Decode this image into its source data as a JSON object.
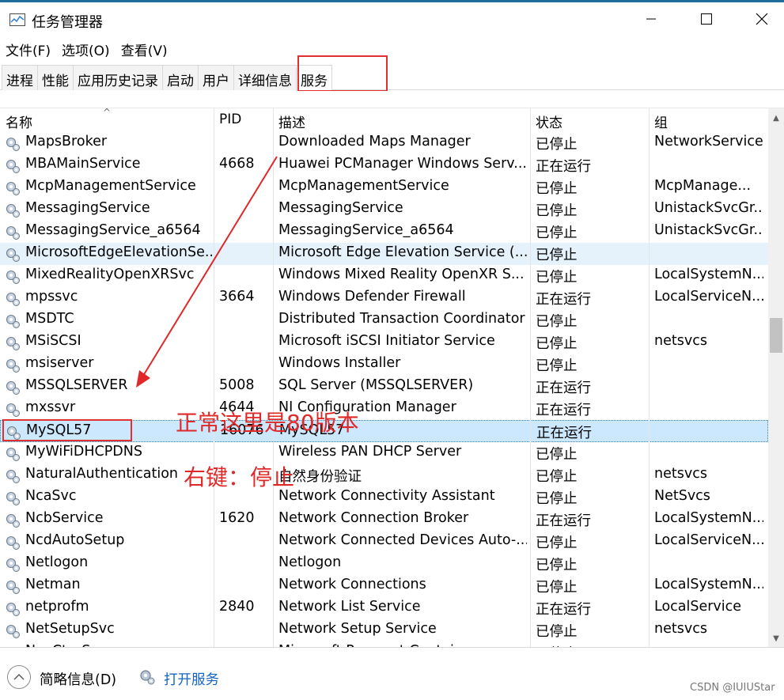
{
  "window": {
    "title": "任务管理器",
    "controls": {
      "minimize": "—",
      "maximize": "☐",
      "close": "✕"
    }
  },
  "menu": [
    "文件(F)",
    "选项(O)",
    "查看(V)"
  ],
  "tabs": [
    {
      "label": "进程",
      "active": false
    },
    {
      "label": "性能",
      "active": false
    },
    {
      "label": "应用历史记录",
      "active": false
    },
    {
      "label": "启动",
      "active": false
    },
    {
      "label": "用户",
      "active": false
    },
    {
      "label": "详细信息",
      "active": false
    },
    {
      "label": "服务",
      "active": true
    }
  ],
  "table": {
    "columns": {
      "name": "名称",
      "pid": "PID",
      "desc": "描述",
      "status": "状态",
      "group": "组"
    },
    "sort_indicator": "^",
    "rows": [
      {
        "name": "MapsBroker",
        "pid": "",
        "desc": "Downloaded Maps Manager",
        "status": "已停止",
        "group": "NetworkService",
        "state": "normal"
      },
      {
        "name": "MBAMainService",
        "pid": "4668",
        "desc": "Huawei PCManager Windows Serv...",
        "status": "正在运行",
        "group": "",
        "state": "normal"
      },
      {
        "name": "McpManagementService",
        "pid": "",
        "desc": "McpManagementService",
        "status": "已停止",
        "group": "McpManage...",
        "state": "normal"
      },
      {
        "name": "MessagingService",
        "pid": "",
        "desc": "MessagingService",
        "status": "已停止",
        "group": "UnistackSvcGr...",
        "state": "normal"
      },
      {
        "name": "MessagingService_a6564",
        "pid": "",
        "desc": "MessagingService_a6564",
        "status": "已停止",
        "group": "UnistackSvcGr...",
        "state": "normal"
      },
      {
        "name": "MicrosoftEdgeElevationSe...",
        "pid": "",
        "desc": "Microsoft Edge Elevation Service (...",
        "status": "已停止",
        "group": "",
        "state": "hover"
      },
      {
        "name": "MixedRealityOpenXRSvc",
        "pid": "",
        "desc": "Windows Mixed Reality OpenXR S...",
        "status": "已停止",
        "group": "LocalSystemN...",
        "state": "normal"
      },
      {
        "name": "mpssvc",
        "pid": "3664",
        "desc": "Windows Defender Firewall",
        "status": "正在运行",
        "group": "LocalServiceN...",
        "state": "normal"
      },
      {
        "name": "MSDTC",
        "pid": "",
        "desc": "Distributed Transaction Coordinator",
        "status": "已停止",
        "group": "",
        "state": "normal"
      },
      {
        "name": "MSiSCSI",
        "pid": "",
        "desc": "Microsoft iSCSI Initiator Service",
        "status": "已停止",
        "group": "netsvcs",
        "state": "normal"
      },
      {
        "name": "msiserver",
        "pid": "",
        "desc": "Windows Installer",
        "status": "已停止",
        "group": "",
        "state": "normal"
      },
      {
        "name": "MSSQLSERVER",
        "pid": "5008",
        "desc": "SQL Server (MSSQLSERVER)",
        "status": "正在运行",
        "group": "",
        "state": "normal"
      },
      {
        "name": "mxssvr",
        "pid": "4644",
        "desc": "NI Configuration Manager",
        "status": "正在运行",
        "group": "",
        "state": "normal"
      },
      {
        "name": "MySQL57",
        "pid": "16076",
        "desc": "MySQL57",
        "status": "正在运行",
        "group": "",
        "state": "selected"
      },
      {
        "name": "MyWiFiDHCPDNS",
        "pid": "",
        "desc": "Wireless PAN DHCP Server",
        "status": "已停止",
        "group": "",
        "state": "normal"
      },
      {
        "name": "NaturalAuthentication",
        "pid": "",
        "desc": "自然身份验证",
        "status": "已停止",
        "group": "netsvcs",
        "state": "normal"
      },
      {
        "name": "NcaSvc",
        "pid": "",
        "desc": "Network Connectivity Assistant",
        "status": "已停止",
        "group": "NetSvcs",
        "state": "normal"
      },
      {
        "name": "NcbService",
        "pid": "1620",
        "desc": "Network Connection Broker",
        "status": "正在运行",
        "group": "LocalSystemN...",
        "state": "normal"
      },
      {
        "name": "NcdAutoSetup",
        "pid": "",
        "desc": "Network Connected Devices Auto-...",
        "status": "已停止",
        "group": "LocalServiceN...",
        "state": "normal"
      },
      {
        "name": "Netlogon",
        "pid": "",
        "desc": "Netlogon",
        "status": "已停止",
        "group": "",
        "state": "normal"
      },
      {
        "name": "Netman",
        "pid": "",
        "desc": "Network Connections",
        "status": "已停止",
        "group": "LocalSystemN...",
        "state": "normal"
      },
      {
        "name": "netprofm",
        "pid": "2840",
        "desc": "Network List Service",
        "status": "正在运行",
        "group": "LocalService",
        "state": "normal"
      },
      {
        "name": "NetSetupSvc",
        "pid": "",
        "desc": "Network Setup Service",
        "status": "已停止",
        "group": "netsvcs",
        "state": "normal"
      },
      {
        "name": "NgcCtnrSvc",
        "pid": "",
        "desc": "Microsoft Passport Container",
        "status": "已停止",
        "group": "",
        "state": "normal"
      }
    ]
  },
  "scrollbar": {
    "up": "▲",
    "down": "▼"
  },
  "footer": {
    "brief_label": "简略信息(D)",
    "open_services_label": "打开服务",
    "watermark": "CSDN @IUIUStar"
  },
  "annotations": {
    "note1": "正常这里是80版本",
    "note2": "右键：停止"
  },
  "colors": {
    "annotation_red": "#e02828",
    "link_blue": "#1565c0",
    "hover_row": "#e5f1fb",
    "selected_row": "#cce8ff"
  }
}
